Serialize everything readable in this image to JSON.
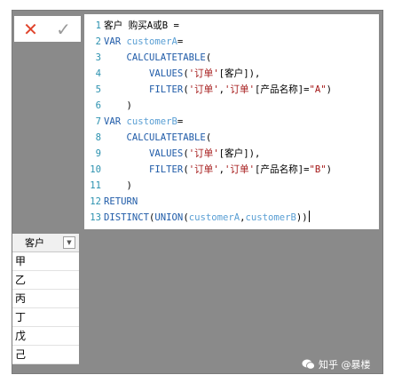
{
  "formula_bar": {
    "cancel_icon": "✕",
    "confirm_icon": "✓",
    "lines": [
      {
        "n": "1",
        "tokens": [
          [
            "tx",
            "客户 购买A或B ="
          ]
        ]
      },
      {
        "n": "2",
        "tokens": [
          [
            "kw",
            "VAR "
          ],
          [
            "var",
            "customerA"
          ],
          [
            "tx",
            "="
          ]
        ]
      },
      {
        "n": "3",
        "tokens": [
          [
            "tx",
            "    "
          ],
          [
            "fn",
            "CALCULATETABLE"
          ],
          [
            "tx",
            "("
          ]
        ]
      },
      {
        "n": "4",
        "tokens": [
          [
            "tx",
            "        "
          ],
          [
            "fn",
            "VALUES"
          ],
          [
            "tx",
            "("
          ],
          [
            "str",
            "'订单'"
          ],
          [
            "tx",
            "[客户]),"
          ]
        ]
      },
      {
        "n": "5",
        "tokens": [
          [
            "tx",
            "        "
          ],
          [
            "fn",
            "FILTER"
          ],
          [
            "tx",
            "("
          ],
          [
            "str",
            "'订单'"
          ],
          [
            "tx",
            ","
          ],
          [
            "str",
            "'订单'"
          ],
          [
            "tx",
            "[产品名称]="
          ],
          [
            "str",
            "\"A\""
          ],
          [
            "tx",
            ")"
          ]
        ]
      },
      {
        "n": "6",
        "tokens": [
          [
            "tx",
            "    )"
          ]
        ]
      },
      {
        "n": "7",
        "tokens": [
          [
            "kw",
            "VAR "
          ],
          [
            "var",
            "customerB"
          ],
          [
            "tx",
            "="
          ]
        ]
      },
      {
        "n": "8",
        "tokens": [
          [
            "tx",
            "    "
          ],
          [
            "fn",
            "CALCULATETABLE"
          ],
          [
            "tx",
            "("
          ]
        ]
      },
      {
        "n": "9",
        "tokens": [
          [
            "tx",
            "        "
          ],
          [
            "fn",
            "VALUES"
          ],
          [
            "tx",
            "("
          ],
          [
            "str",
            "'订单'"
          ],
          [
            "tx",
            "[客户]),"
          ]
        ]
      },
      {
        "n": "10",
        "tokens": [
          [
            "tx",
            "        "
          ],
          [
            "fn",
            "FILTER"
          ],
          [
            "tx",
            "("
          ],
          [
            "str",
            "'订单'"
          ],
          [
            "tx",
            ","
          ],
          [
            "str",
            "'订单'"
          ],
          [
            "tx",
            "[产品名称]="
          ],
          [
            "str",
            "\"B\""
          ],
          [
            "tx",
            ")"
          ]
        ]
      },
      {
        "n": "11",
        "tokens": [
          [
            "tx",
            "    )"
          ]
        ]
      },
      {
        "n": "12",
        "tokens": [
          [
            "kw",
            "RETURN"
          ]
        ]
      },
      {
        "n": "13",
        "tokens": [
          [
            "fn",
            "DISTINCT"
          ],
          [
            "tx",
            "("
          ],
          [
            "fn",
            "UNION"
          ],
          [
            "tx",
            "("
          ],
          [
            "var",
            "customerA"
          ],
          [
            "tx",
            ","
          ],
          [
            "var",
            "customerB"
          ],
          [
            "tx",
            "))"
          ]
        ]
      }
    ]
  },
  "table": {
    "header": "客户",
    "filter_icon": "▼",
    "rows": [
      "甲",
      "乙",
      "丙",
      "丁",
      "戊",
      "己"
    ]
  },
  "watermark": {
    "text": "知乎 @暴楼"
  },
  "colors": {
    "keyword": "#1f5ba8",
    "variable": "#5a9fd4",
    "string": "#a31515",
    "line_number": "#2b91af",
    "cancel": "#e0442c",
    "background_gray": "#8a8a8a"
  }
}
